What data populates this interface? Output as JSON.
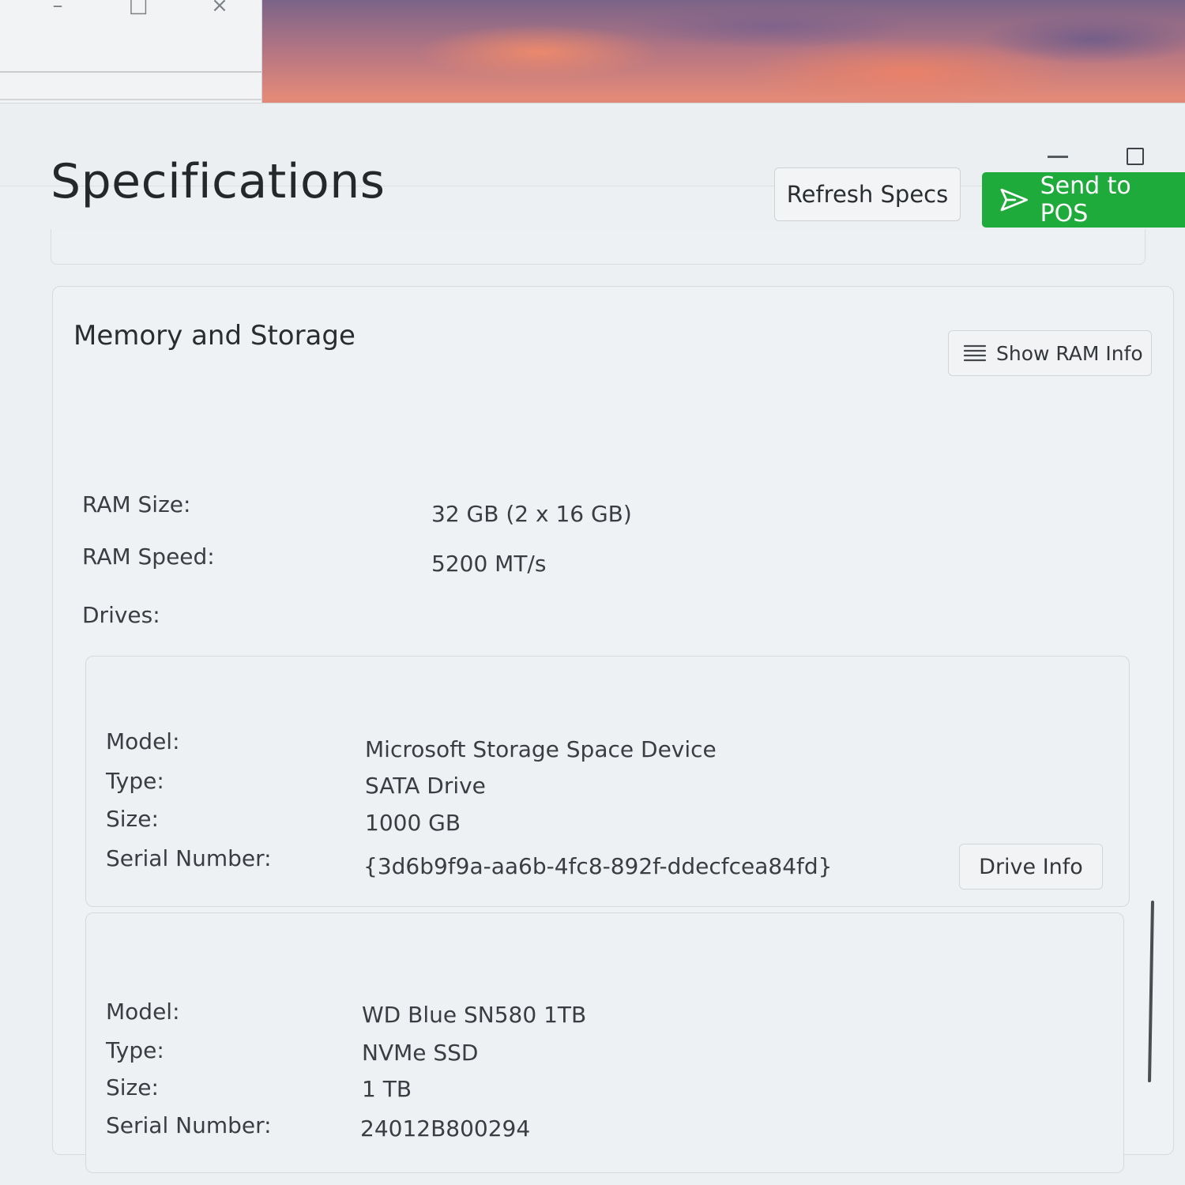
{
  "background_window": {
    "controls": [
      "–",
      "□",
      "×"
    ]
  },
  "window": {
    "minimize_glyph": "",
    "maximize_glyph": ""
  },
  "header": {
    "title": "Specifications",
    "refresh_label": "Refresh Specs",
    "send_label": "Send to POS",
    "send_icon": "send-icon",
    "send_color": "#1faa3c"
  },
  "memory": {
    "title": "Memory and Storage",
    "show_ram_label": "Show RAM Info",
    "show_ram_icon": "list-icon",
    "ram_size_label": "RAM Size:",
    "ram_size_value": "32 GB (2 x 16 GB)",
    "ram_speed_label": "RAM Speed:",
    "ram_speed_value": "5200 MT/s",
    "drives_label": "Drives:"
  },
  "drives": [
    {
      "model_label": "Model:",
      "model": "Microsoft Storage Space Device",
      "type_label": "Type:",
      "type": "SATA Drive",
      "size_label": "Size:",
      "size": "1000 GB",
      "serial_label": "Serial Number:",
      "serial": "{3d6b9f9a-aa6b-4fc8-892f-ddecfcea84fd}"
    },
    {
      "drive_info_label": "Drive Info",
      "model_label": "Model:",
      "model": "WD Blue SN580 1TB",
      "type_label": "Type:",
      "type": "NVMe SSD",
      "size_label": "Size:",
      "size": "1 TB",
      "serial_label": "Serial Number:",
      "serial": "24012B800294"
    }
  ]
}
